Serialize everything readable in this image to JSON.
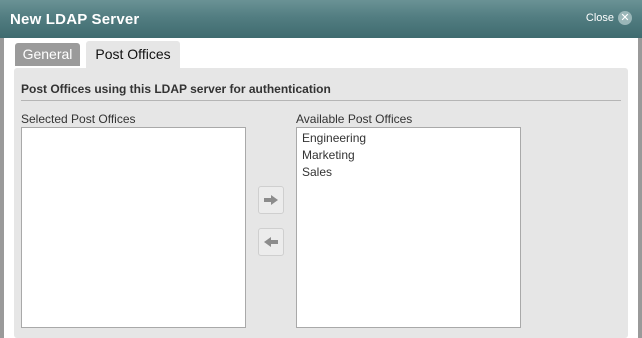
{
  "dialog": {
    "title": "New LDAP Server",
    "close_label": "Close",
    "close_icon": "close-icon"
  },
  "tabs": [
    {
      "label": "General",
      "active": false
    },
    {
      "label": "Post Offices",
      "active": true
    }
  ],
  "post_offices": {
    "heading": "Post Offices using this LDAP server for authentication",
    "selected_label": "Selected Post Offices",
    "selected_items": [],
    "available_label": "Available Post Offices",
    "available_items": [
      "Engineering",
      "Marketing",
      "Sales"
    ],
    "add_icon": "arrow-right-icon",
    "remove_icon": "arrow-left-icon"
  },
  "colors": {
    "titlebar": "#527d81",
    "panel": "#e6e6e6",
    "inactive_tab": "#9b9b9b"
  }
}
